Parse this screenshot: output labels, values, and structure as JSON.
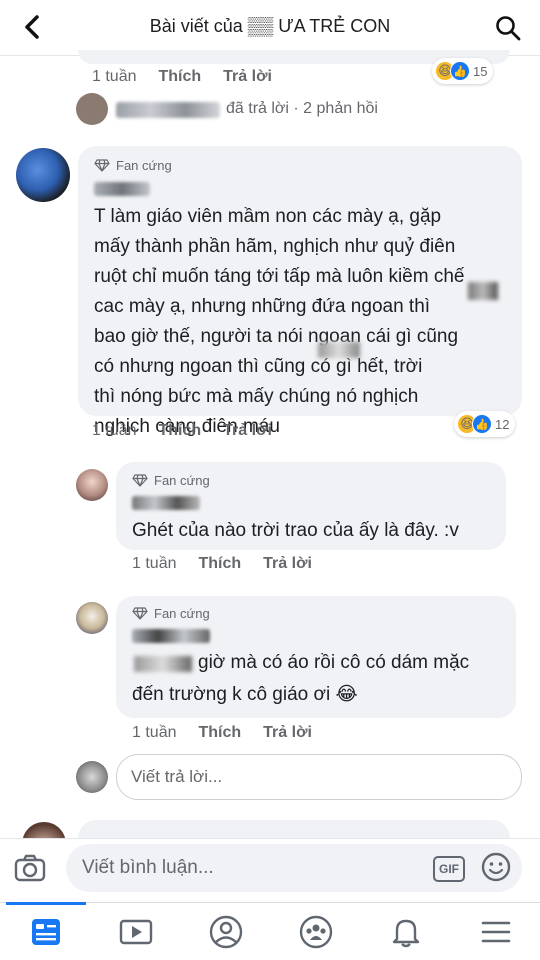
{
  "header": {
    "title": "Bài viết của ▒▒ ƯA TRẺ CON"
  },
  "top_meta": {
    "time": "1 tuần",
    "like": "Thích",
    "reply": "Trả lời",
    "reaction_count": "15"
  },
  "replied_notice": {
    "text": "đã trả lời · 2 phản hồi"
  },
  "main_comment": {
    "badge": "Fan cứng",
    "text_lines": [
      "T làm giáo viên mầm non các mày ạ, gặp",
      "mấy thành phần hãm, nghịch như quỷ điên",
      "ruột chỉ muốn táng tới tấp mà luôn kiềm chế",
      "cac mày ạ, nhưng những đứa ngoan thì",
      "bao giờ thế, người ta nói ngoan cái gì cũng",
      "có nhưng ngoan thì cũng      có gì hết, trời",
      "thì nóng bức mà mấy chúng nó nghịch",
      "nghịch càng điên máu"
    ],
    "time": "1 tuần",
    "like": "Thích",
    "reply": "Trả lời",
    "reaction_count": "12"
  },
  "reply1": {
    "badge": "Fan cứng",
    "text": "Ghét của nào trời trao của ấy là đây. :v",
    "time": "1 tuần",
    "like": "Thích",
    "reply": "Trả lời"
  },
  "reply2": {
    "badge": "Fan cứng",
    "text_line1": "giờ mà có áo rồi cô có dám mặc",
    "text_line2": "đến trường k cô giáo ơi 😂",
    "time": "1 tuần",
    "like": "Thích",
    "reply": "Trả lời"
  },
  "reply_input": {
    "placeholder": "Viết trả lời..."
  },
  "composer": {
    "placeholder": "Viết bình luận...",
    "gif_label": "GIF"
  },
  "colors": {
    "accent": "#1877f2",
    "bubble": "#f0f2f5",
    "meta_text": "#65676b"
  },
  "icons": {
    "header": [
      "back-arrow-icon",
      "search-icon"
    ],
    "composer": [
      "camera-icon",
      "gif-icon",
      "emoji-icon"
    ],
    "tabs": [
      "news-feed-icon",
      "watch-icon",
      "profile-icon",
      "groups-icon",
      "notifications-icon",
      "menu-icon"
    ]
  }
}
